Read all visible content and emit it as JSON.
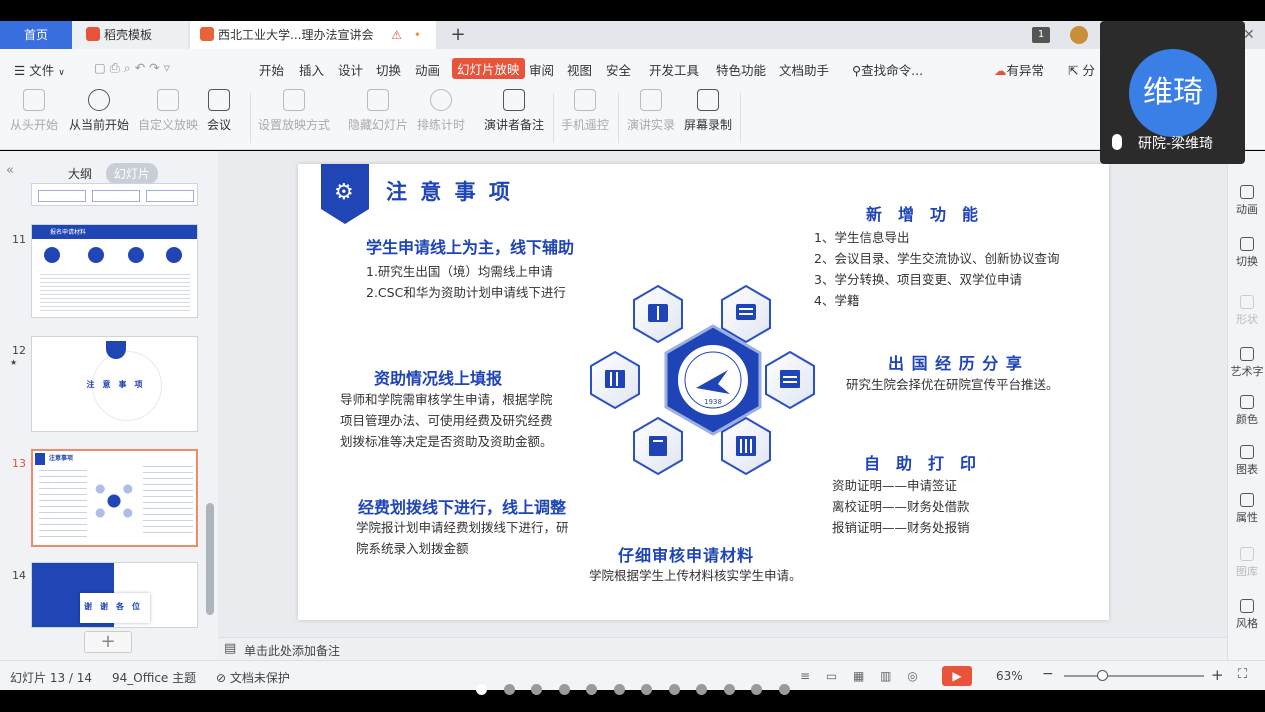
{
  "tabs": {
    "home": "首页",
    "tab1": "稻壳模板",
    "tab2": "西北工业大学...理办法宣讲会",
    "warning": "⚠",
    "dot": "•",
    "plus": "+",
    "badge": "1"
  },
  "menu": {
    "file": "文件",
    "items": [
      "开始",
      "插入",
      "设计",
      "切换",
      "动画",
      "幻灯片放映",
      "审阅",
      "视图",
      "安全",
      "开发工具",
      "特色功能",
      "文档助手"
    ],
    "active": "幻灯片放映",
    "search": "查找命令...",
    "status": "有异常",
    "share": "分"
  },
  "toolbar": {
    "items": [
      {
        "label": "从头开始",
        "disabled": true
      },
      {
        "label": "从当前开始",
        "disabled": false
      },
      {
        "label": "自定义放映",
        "disabled": true
      },
      {
        "label": "会议",
        "disabled": false
      },
      {
        "label": "设置放映方式",
        "disabled": true
      },
      {
        "label": "隐藏幻灯片",
        "disabled": true
      },
      {
        "label": "排练计时",
        "disabled": true
      },
      {
        "label": "演讲者备注",
        "disabled": false
      },
      {
        "label": "手机遥控",
        "disabled": true
      },
      {
        "label": "演讲实录",
        "disabled": true
      },
      {
        "label": "屏幕录制",
        "disabled": false
      }
    ]
  },
  "leftpane": {
    "collapse": "«",
    "tab_outline": "大纲",
    "tab_slides": "幻灯片",
    "slides": [
      {
        "num": "11",
        "title": "报名申请材料"
      },
      {
        "num": "12",
        "star": "★",
        "title": "注　意　事　项"
      },
      {
        "num": "13",
        "title": "注意事项"
      },
      {
        "num": "14",
        "title": "谢　谢　各　位"
      }
    ],
    "add": "+"
  },
  "slide": {
    "title": "注 意 事 项",
    "s1_head": "学生申请线上为主，线下辅助",
    "s1_l1": "1.研究生出国（境）均需线上申请",
    "s1_l2": "2.CSC和华为资助计划申请线下进行",
    "s2_head": "资助情况线上填报",
    "s2_l1": "导师和学院需审核学生申请，根据学院",
    "s2_l2": "项目管理办法、可使用经费及研究经费",
    "s2_l3": "划拨标准等决定是否资助及资助金额。",
    "s3_head": "经费划拨线下进行，线上调整",
    "s3_l1": "学院报计划申请经费划拨线下进行，研",
    "s3_l2": "院系统录入划拨金额",
    "s4_head": "仔细审核申请材料",
    "s4_l1": "学院根据学生上传材料核实学生申请。",
    "r1_head": "新　增　功　能",
    "r1_l1": "1、学生信息导出",
    "r1_l2": "2、会议目录、学生交流协议、创新协议查询",
    "r1_l3": "3、学分转换、项目变更、双学位申请",
    "r1_l4": "4、学籍",
    "r2_head": "出 国 经 历 分 享",
    "r2_l1": "研究生院会择优在研院宣传平台推送。",
    "r3_head": "自　助　打　印",
    "r3_l1": "资助证明——申请签证",
    "r3_l2": "离校证明——财务处借款",
    "r3_l3": "报销证明——财务处报销",
    "logo_year": "1938"
  },
  "notes": {
    "placeholder": "单击此处添加备注"
  },
  "rightpane": [
    {
      "label": "动画",
      "disabled": false
    },
    {
      "label": "切换",
      "disabled": false
    },
    {
      "label": "形状",
      "disabled": true
    },
    {
      "label": "艺术字",
      "disabled": false
    },
    {
      "label": "颜色",
      "disabled": false
    },
    {
      "label": "图表",
      "disabled": false
    },
    {
      "label": "属性",
      "disabled": false
    },
    {
      "label": "图库",
      "disabled": true
    },
    {
      "label": "风格",
      "disabled": false
    }
  ],
  "status": {
    "slide_counter": "幻灯片 13 / 14",
    "theme": "94_Office 主题",
    "protect": "文档未保护",
    "zoom": "63%",
    "minus": "−",
    "plus": "+"
  },
  "video": {
    "avatar_text": "维琦",
    "name": "研院-梁维琦"
  },
  "colors": {
    "accent": "#1f44b8",
    "tab_active": "#3a6fe0",
    "play": "#e8533a"
  }
}
